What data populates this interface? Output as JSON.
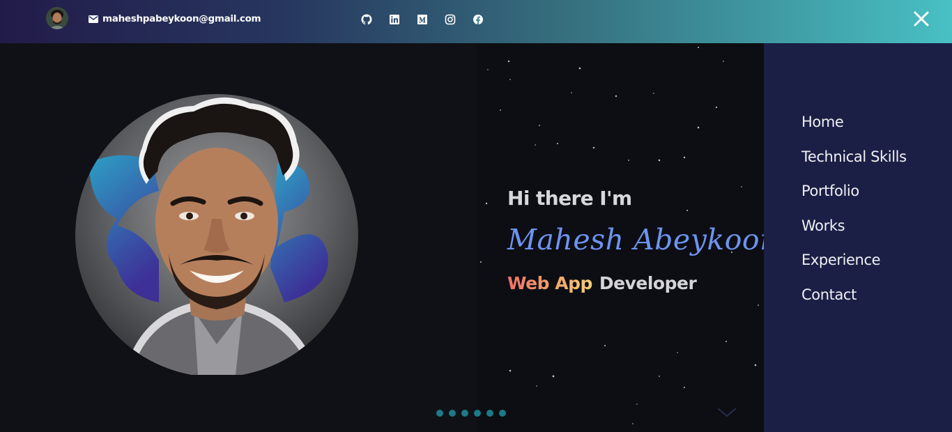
{
  "header": {
    "email": "maheshpabeykoon@gmail.com",
    "avatar_icon": "avatar",
    "email_icon": "mail-icon",
    "socials": [
      "github-icon",
      "linkedin-icon",
      "medium-icon",
      "instagram-icon",
      "facebook-icon"
    ],
    "close_icon": "close-icon"
  },
  "hero": {
    "greeting": "Hi there I'm",
    "name": "Mahesh Abeykoon",
    "role_highlight": "Web App",
    "role_rest": "Developer"
  },
  "nav": {
    "items": [
      "Home",
      "Technical Skills",
      "Portfolio",
      "Works",
      "Experience",
      "Contact"
    ]
  },
  "pagination": {
    "dots": 6
  },
  "colors": {
    "name": "#6e93f0",
    "sidebar": "#1b1f45",
    "dot": "#1d7a86",
    "topbar_start": "#221b49",
    "topbar_end": "#48c0c4"
  }
}
